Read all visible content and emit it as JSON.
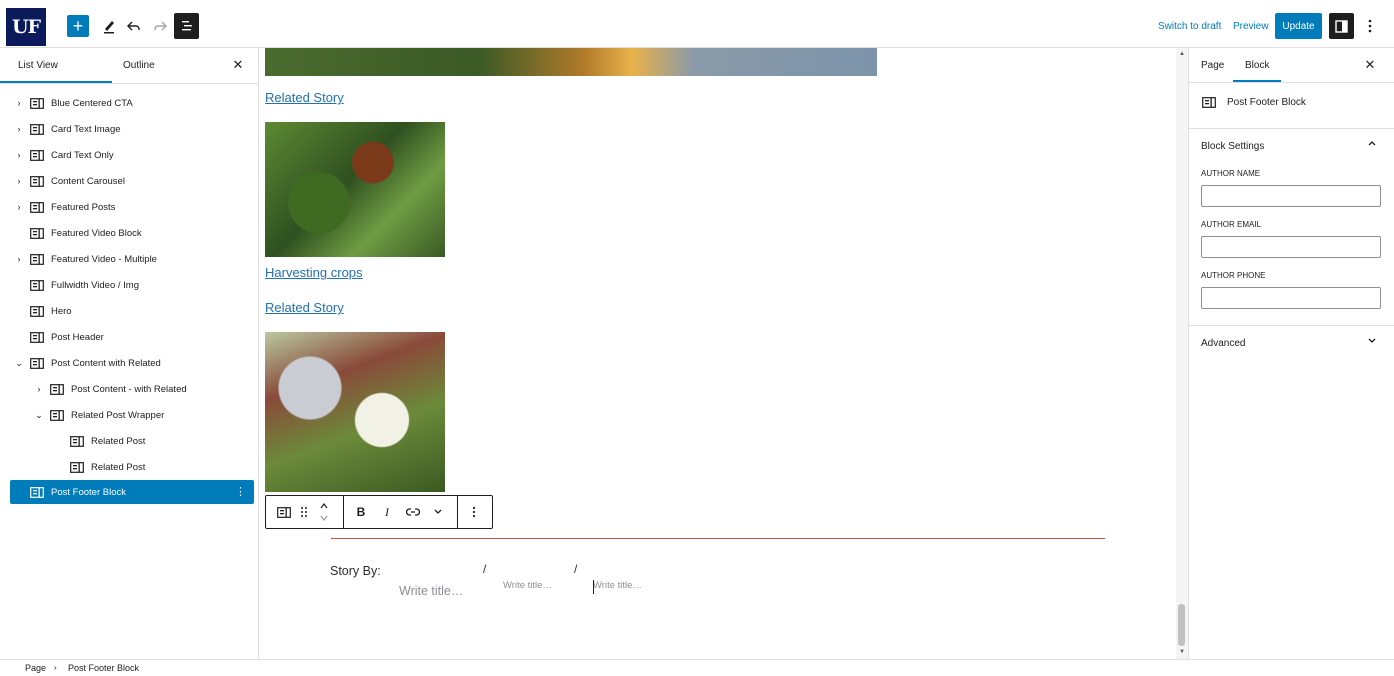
{
  "toolbar": {
    "logo_text": "UF",
    "add_icon": "plus-icon",
    "switch_to_draft": "Switch to draft",
    "preview": "Preview",
    "update": "Update"
  },
  "left_panel": {
    "tab_list_view": "List View",
    "tab_outline": "Outline",
    "items": [
      {
        "label": "Blue Centered CTA",
        "expandable": true
      },
      {
        "label": "Card Text Image",
        "expandable": true
      },
      {
        "label": "Card Text Only",
        "expandable": true
      },
      {
        "label": "Content Carousel",
        "expandable": true
      },
      {
        "label": "Featured Posts",
        "expandable": true
      },
      {
        "label": "Featured Video Block",
        "expandable": false
      },
      {
        "label": "Featured Video - Multiple",
        "expandable": true
      },
      {
        "label": "Fullwidth Video / Img",
        "expandable": false
      },
      {
        "label": "Hero",
        "expandable": false
      },
      {
        "label": "Post Header",
        "expandable": false
      },
      {
        "label": "Post Content with Related",
        "expanded": true
      },
      {
        "label": "Post Content - with Related",
        "expandable": true
      },
      {
        "label": "Related Post Wrapper",
        "expanded": true
      },
      {
        "label": "Related Post"
      },
      {
        "label": "Related Post"
      },
      {
        "label": "Post Footer Block",
        "selected": true
      }
    ]
  },
  "canvas": {
    "related_story_1": "Related Story",
    "harvesting_crops": "Harvesting crops",
    "related_story_2": "Related Story",
    "block_toolbar": {
      "bold": "B",
      "italic": "I"
    },
    "story_by": "Story By:",
    "slash": "/",
    "write_title_1": "Write title…",
    "write_title_2": "Write title…",
    "write_title_3": "Write title…",
    "accent_color": "#d94c3a"
  },
  "right_panel": {
    "tab_page": "Page",
    "tab_block": "Block",
    "block_name": "Post Footer Block",
    "block_settings": "Block Settings",
    "author_name_label": "AUTHOR NAME",
    "author_name_value": "",
    "author_email_label": "AUTHOR EMAIL",
    "author_email_value": "",
    "author_phone_label": "AUTHOR PHONE",
    "author_phone_value": "",
    "advanced": "Advanced"
  },
  "breadcrumb": {
    "root": "Page",
    "current": "Post Footer Block"
  },
  "colors": {
    "accent": "#007cba",
    "logo_bg": "#0b1a5b"
  }
}
